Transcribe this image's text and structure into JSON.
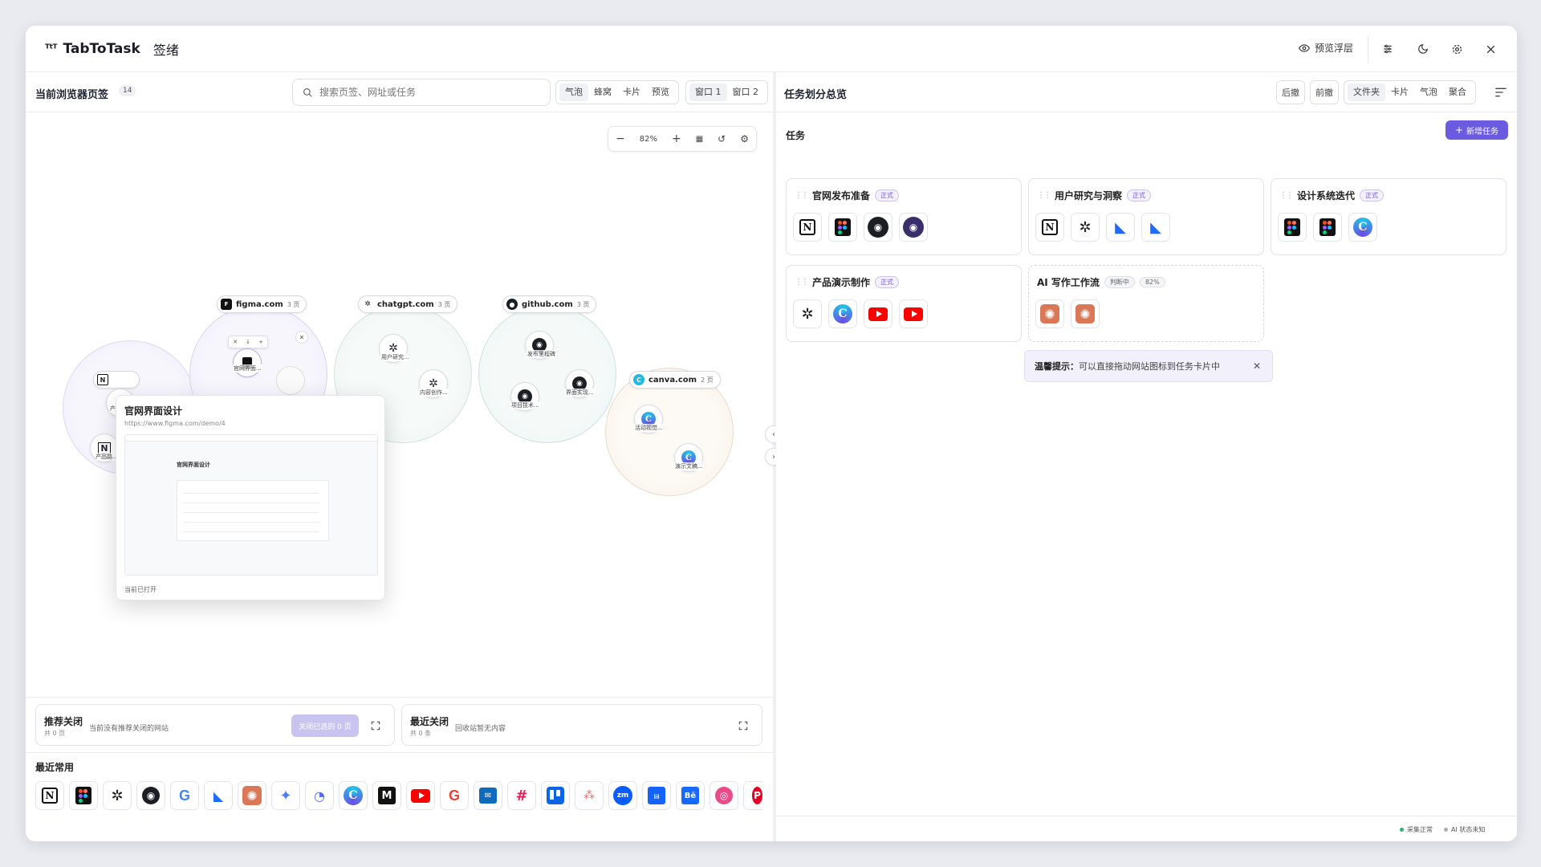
{
  "app": {
    "brand_glyph": "ᵀᵗᵀ",
    "brand": "TabToTask",
    "subtitle": "签绪"
  },
  "topbar": {
    "preview_label": "预览浮层"
  },
  "left": {
    "title": "当前浏览器页签",
    "tab_count": "14",
    "search_placeholder": "搜索页签、网址或任务",
    "view_modes": [
      "气泡",
      "蜂窝",
      "卡片",
      "预览"
    ],
    "windows": [
      "窗口 1",
      "窗口 2"
    ],
    "zoom": "82%",
    "domains": [
      {
        "name": "figma.com",
        "pages": "3 页"
      },
      {
        "name": "chatgpt.com",
        "pages": "3 页"
      },
      {
        "name": "github.com",
        "pages": "3 页"
      },
      {
        "name": "canva.com",
        "pages": "2 页"
      }
    ],
    "nodes": {
      "figma_1": "官网界面...",
      "chatgpt_1": "用户研究...",
      "chatgpt_2": "内容创作...",
      "github_1": "发布里程碑",
      "github_2": "界面实现...",
      "github_3": "项目技术...",
      "canva_1": "活动视觉...",
      "canva_2": "演示文稿...",
      "notion_1": "产",
      "notion_2": "产品路..."
    },
    "popup": {
      "title": "官网界面设计",
      "url": "https://www.figma.com/demo/4",
      "status": "当前已打开",
      "shot_title": "官网界面设计"
    },
    "recommend": {
      "title": "推荐关闭",
      "sub": "共 0 页",
      "desc": "当前没有推荐关闭的网站",
      "button": "关闭已选的 0 页"
    },
    "recent_closed": {
      "title": "最近关闭",
      "sub": "共 0 条",
      "desc": "回收站暂无内容"
    },
    "recent_title": "最近常用"
  },
  "right": {
    "title": "任务划分总览",
    "undo": "后撤",
    "redo": "前撤",
    "views": [
      "文件夹",
      "卡片",
      "气泡",
      "聚合"
    ],
    "section": "任务",
    "new_task": "新增任务",
    "cards": [
      {
        "title": "官网发布准备",
        "badge": "正式"
      },
      {
        "title": "用户研究与洞察",
        "badge": "正式"
      },
      {
        "title": "设计系统迭代",
        "badge": "正式"
      },
      {
        "title": "产品演示制作",
        "badge": "正式"
      },
      {
        "title": "AI 写作工作流",
        "badge": "判断中",
        "badge2": "82%"
      }
    ],
    "tip_bold": "温馨提示：",
    "tip_text": "可以直接拖动网站图标到任务卡片中"
  },
  "status": {
    "collect": "采集正常",
    "ai": "AI 状态未知"
  },
  "colors": {
    "accent": "#6b5be0",
    "ok": "#2bb673"
  }
}
